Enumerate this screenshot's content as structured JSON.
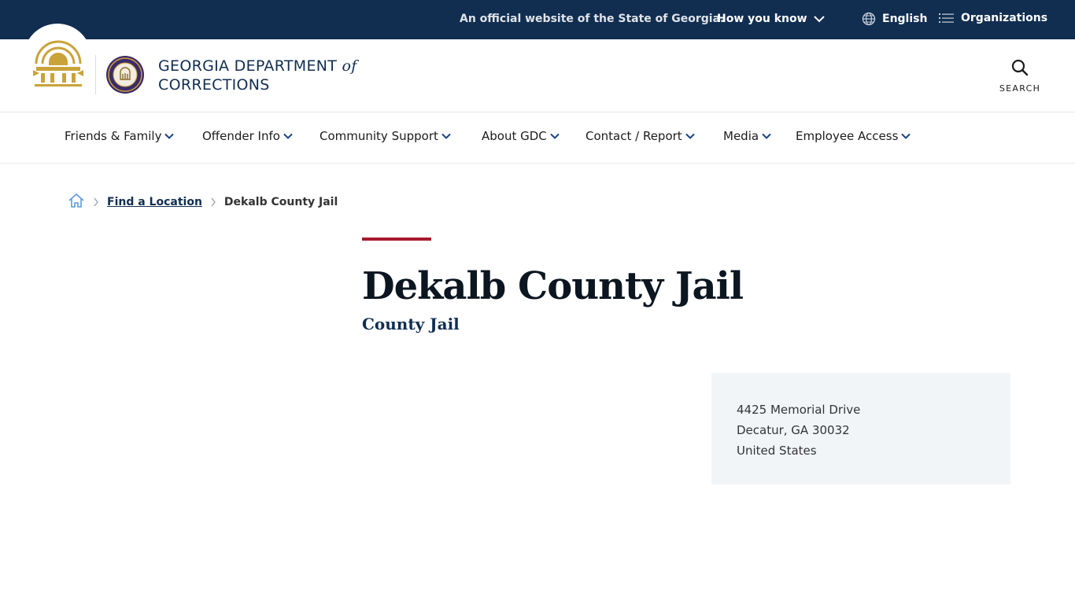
{
  "banner": {
    "official_text": "An official website of the State of Georgia.",
    "how_you_know": "How you know",
    "language": "English",
    "organizations": "Organizations"
  },
  "header": {
    "brand_line1": "GEORGIA DEPARTMENT",
    "brand_of": "of",
    "brand_line2": "CORRECTIONS",
    "search_label": "SEARCH"
  },
  "nav": {
    "items": [
      {
        "label": "Friends & Family"
      },
      {
        "label": "Offender Info"
      },
      {
        "label": "Community Support"
      },
      {
        "label": "About GDC"
      },
      {
        "label": "Contact / Report"
      },
      {
        "label": "Media"
      },
      {
        "label": "Employee Access"
      }
    ]
  },
  "breadcrumb": {
    "parent": "Find a Location",
    "current": "Dekalb County Jail"
  },
  "page": {
    "title": "Dekalb County Jail",
    "subtitle": "County Jail"
  },
  "address": {
    "street": "4425 Memorial Drive",
    "city_state_zip": "Decatur, GA 30032",
    "country": "United States"
  },
  "colors": {
    "banner_bg": "#112e51",
    "accent_red": "#a6192e",
    "gold": "#c9a23a",
    "navy": "#112e51",
    "card_bg": "#f2f5f8"
  },
  "icons": {
    "how_you_know": "chevron-down-icon",
    "language": "globe-icon",
    "organizations": "list-icon",
    "search": "search-icon",
    "home": "home-icon",
    "crumb_sep": "chevron-right-icon",
    "nav_chevron": "chevron-down-icon"
  }
}
